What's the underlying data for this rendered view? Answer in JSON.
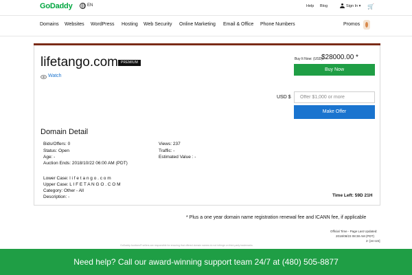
{
  "header": {
    "logo": "GoDaddy",
    "language": "EN",
    "help": "Help",
    "blog": "Blog",
    "sign_in": "Sign In ▾",
    "cart_icon": "cart-icon"
  },
  "nav": {
    "items": [
      "Domains",
      "Websites",
      "WordPress",
      "Hosting",
      "Web Security",
      "Online Marketing",
      "Email & Office",
      "Phone Numbers"
    ],
    "promos": "Promos"
  },
  "listing": {
    "domain": "lifetango.com",
    "badge": "PREMIUM",
    "watch": "Watch",
    "buy_label": "Buy It Now: (USD)",
    "price": "$28000.00 *",
    "buy_button": "Buy Now",
    "currency_label": "USD $",
    "offer_placeholder": "Offer $1,000 or more",
    "offer_button": "Make Offer"
  },
  "detail": {
    "title": "Domain Detail",
    "bids": "Bids/Offers: 0",
    "status": "Status: Open",
    "age": "Age: -",
    "auction_ends": "Auction Ends: 2018/10/22 06:00 AM (PDT)",
    "views": "Views: 237",
    "traffic": "Traffic: -",
    "estimated_value": "Estimated Value : -",
    "lower_case": "Lower Case: l i f e t a n g o . c o m",
    "upper_case": "Upper Case: L I F E T A N G O . C O M",
    "category": "Category: Other - All",
    "description": "Description: -",
    "time_left": "Time Left: 59D 21H"
  },
  "footer": {
    "footnote": "* Plus a one year domain name registration renewal fee and ICANN fee, if applicable",
    "official_time": "Official Time - Page Last Updated:",
    "timestamp": "2018/08/23 08:38 AM (PDT)",
    "version": "2- [en-US]",
    "legal": "GoDaddy Auctions® sellers are responsible for ensuring that offered domain names do not infringe on third-party trademarks.",
    "help_text": "Need help? Call our award-winning support team 24/7 at (480) 505-8877"
  },
  "colors": {
    "green": "#1f9e45",
    "blue": "#1a74cf",
    "accent_bar": "#7a2b17"
  }
}
